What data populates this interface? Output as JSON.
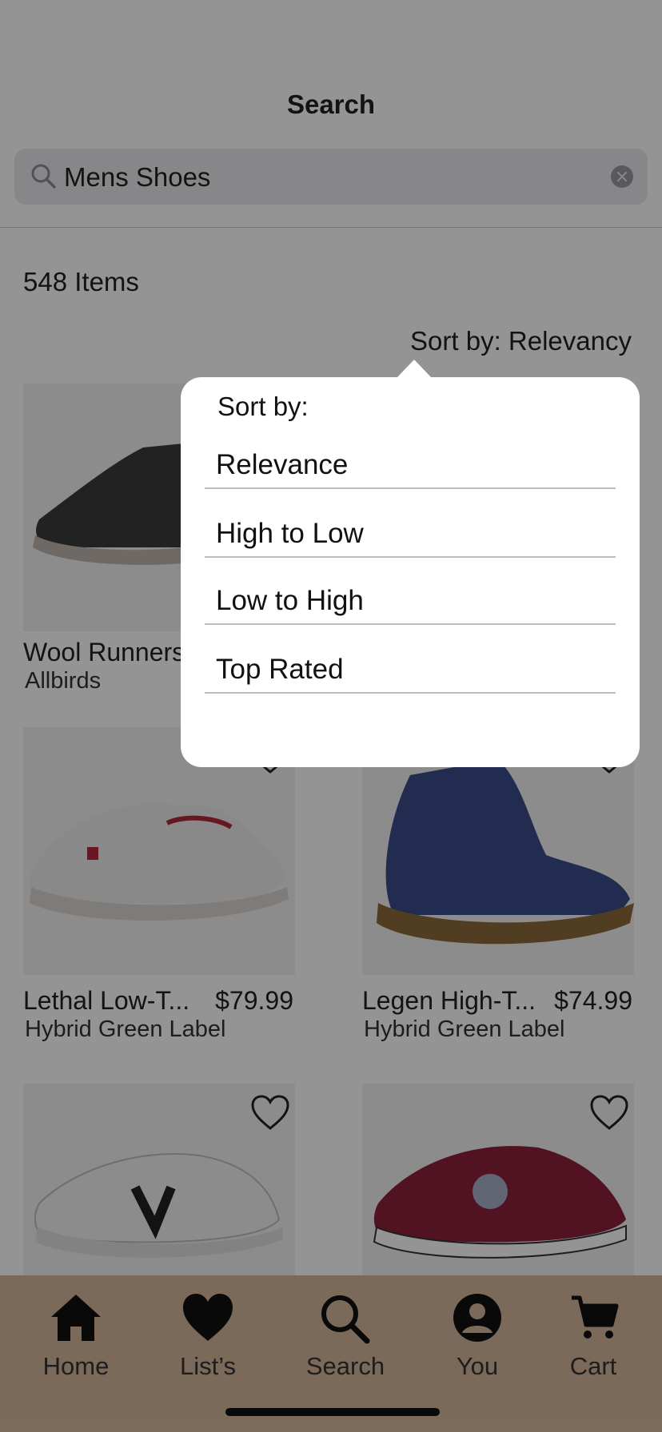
{
  "header": {
    "title": "Search"
  },
  "search": {
    "value": "Mens Shoes"
  },
  "results": {
    "count_label": "548 Items",
    "sort_label": "Sort by: Relevancy"
  },
  "products": [
    {
      "name": "Wool Runners",
      "price": "",
      "brand": "Allbirds"
    },
    {
      "name": "",
      "price": "",
      "brand": ""
    },
    {
      "name": "Lethal Low-T...",
      "price": "$79.99",
      "brand": "Hybrid Green Label"
    },
    {
      "name": "Legen High-T...",
      "price": "$74.99",
      "brand": "Hybrid Green Label"
    },
    {
      "name": "",
      "price": "",
      "brand": ""
    },
    {
      "name": "",
      "price": "",
      "brand": ""
    }
  ],
  "sort_popover": {
    "title": "Sort by:",
    "options": [
      "Relevance",
      "High to Low",
      "Low to High",
      "Top Rated"
    ]
  },
  "tabbar": {
    "items": [
      {
        "label": "Home",
        "icon": "home-icon"
      },
      {
        "label": "List’s",
        "icon": "heart-icon"
      },
      {
        "label": "Search",
        "icon": "search-icon"
      },
      {
        "label": "You",
        "icon": "user-icon"
      },
      {
        "label": "Cart",
        "icon": "cart-icon"
      }
    ]
  },
  "colors": {
    "tabbar_bg": "#d5b79c",
    "scrim": "rgba(0,0,0,0.42)"
  }
}
